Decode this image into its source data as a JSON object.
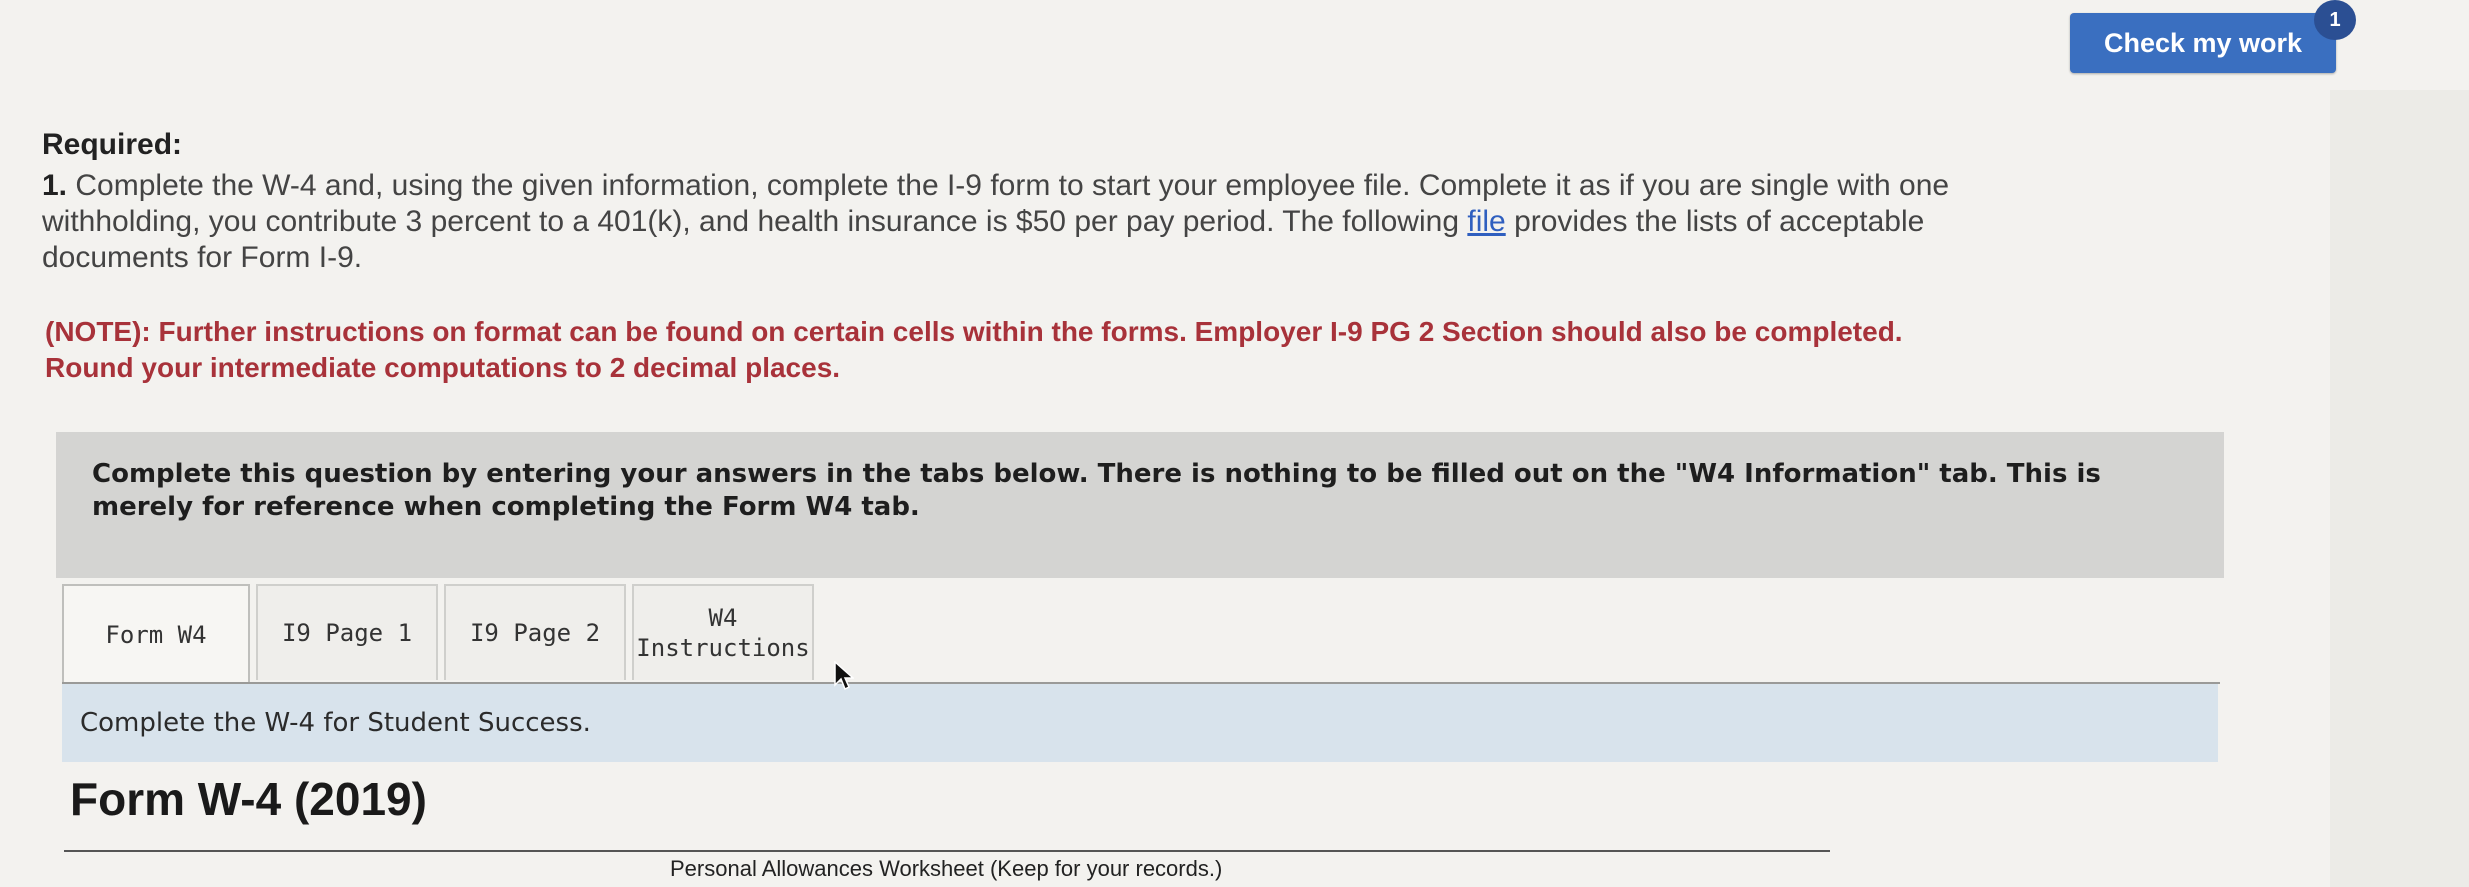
{
  "header": {
    "check_button_label": "Check my work",
    "badge_count": "1"
  },
  "required": {
    "title": "Required:",
    "item_number": "1.",
    "text_before_link": "Complete the W-4 and, using the given information, complete the I-9 form to start your employee file. Complete it as if you are single with one withholding, you contribute 3 percent to a 401(k), and health insurance is $50 per pay period. The following",
    "link_text": "file",
    "text_after_link": "provides the lists of acceptable documents for Form I-9."
  },
  "note": {
    "text": "(NOTE): Further instructions on format can be found on certain cells within the forms. Employer I-9 PG 2 Section should also be completed. Round your intermediate computations to 2 decimal places."
  },
  "instructions": {
    "text": "Complete this question by entering your answers in the tabs below. There is nothing to be filled out on the \"W4 Information\" tab. This is merely for reference when completing the Form W4 tab."
  },
  "tabs": [
    {
      "label": "Form W4",
      "active": true
    },
    {
      "label": "I9 Page 1",
      "active": false
    },
    {
      "label": "I9 Page 2",
      "active": false
    },
    {
      "label": "W4 Instructions",
      "active": false
    }
  ],
  "tab_content": {
    "header_text": "Complete the W-4 for Student Success.",
    "form_title": "Form W-4 (2019)",
    "worksheet_caption": "Personal Allowances Worksheet (Keep for your records.)"
  },
  "colors": {
    "accent_button": "#3a6fc0",
    "note_text": "#a8323a",
    "tab_header_bg": "#d8e3ec"
  }
}
